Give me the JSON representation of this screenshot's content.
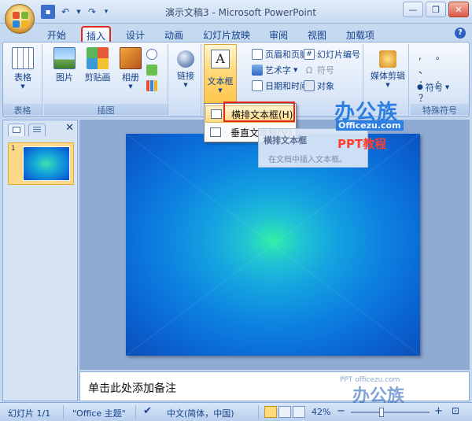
{
  "titlebar": {
    "title": "演示文稿3 - Microsoft PowerPoint",
    "qat": [
      "save-icon",
      "undo-icon",
      "redo-icon",
      "customize-icon"
    ],
    "controls": [
      "—",
      "❐",
      "✕"
    ]
  },
  "tabs": [
    {
      "label": "开始"
    },
    {
      "label": "插入",
      "active": true
    },
    {
      "label": "设计"
    },
    {
      "label": "动画"
    },
    {
      "label": "幻灯片放映"
    },
    {
      "label": "审阅"
    },
    {
      "label": "视图"
    },
    {
      "label": "加载项"
    }
  ],
  "help_label": "?",
  "ribbon": {
    "tables_group": {
      "label": "表格",
      "button": "表格"
    },
    "illustrations_group": {
      "label": "插图",
      "buttons": [
        "图片",
        "剪贴画",
        "相册"
      ]
    },
    "links_group": {
      "button": "链接"
    },
    "text_group": {
      "textbox": "文本框",
      "header_footer": "页眉和页脚",
      "wordart": "艺术字",
      "date_time": "日期和时间",
      "slide_number": "幻灯片编号",
      "symbol": "符号",
      "object": "对象"
    },
    "media_group": {
      "button": "媒体剪辑"
    },
    "special_symbols_group": {
      "label": "特殊符号",
      "symbol_button": "符号",
      "chars": [
        ",",
        "。",
        "、",
        "；",
        "：",
        "？"
      ]
    }
  },
  "dropdown": {
    "items": [
      {
        "label": "横排文本框(H)"
      },
      {
        "label": "垂直文本框(V)"
      }
    ]
  },
  "tooltip": {
    "title": "横排文本框",
    "description": "在文档中插入文本框。"
  },
  "watermark": {
    "brand": "办公族",
    "url": "Officezu.com",
    "subtitle": "PPT教程",
    "bottom_small": "PPT officezu.com",
    "bottom_big": "办公族"
  },
  "left_pane": {
    "slide_number": "1",
    "close_label": "✕"
  },
  "notes": {
    "placeholder": "单击此处添加备注"
  },
  "statusbar": {
    "slide_info": "幻灯片 1/1",
    "theme": "\"Office 主题\"",
    "language": "中文(简体，中国)",
    "zoom": "42%",
    "zoom_out": "−",
    "zoom_in": "+"
  },
  "colors": {
    "accent_red": "#e0281c",
    "ribbon_bg": "#dbe7f7",
    "hover_yellow": "#ffd982"
  }
}
